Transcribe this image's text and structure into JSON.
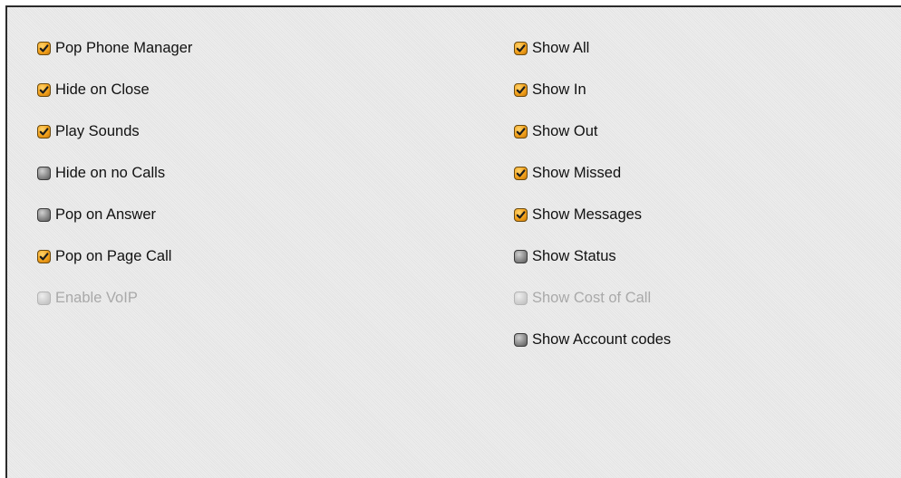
{
  "colors": {
    "checked_fill": "#f3a21c",
    "unchecked_fill": "#8c8c8c",
    "disabled_fill": "#cfcfcf",
    "panel_background": "#e9e9e9",
    "text": "#111111",
    "disabled_text": "#a9a9a9"
  },
  "left_options": [
    {
      "label": "Pop Phone Manager",
      "state": "checked"
    },
    {
      "label": "Hide on Close",
      "state": "checked"
    },
    {
      "label": "Play Sounds",
      "state": "checked"
    },
    {
      "label": "Hide on no Calls",
      "state": "unchecked"
    },
    {
      "label": "Pop on Answer",
      "state": "unchecked"
    },
    {
      "label": "Pop on Page Call",
      "state": "checked"
    },
    {
      "label": "Enable VoIP",
      "state": "disabled"
    }
  ],
  "right_options": [
    {
      "label": "Show All",
      "state": "checked"
    },
    {
      "label": "Show In",
      "state": "checked"
    },
    {
      "label": "Show Out",
      "state": "checked"
    },
    {
      "label": "Show Missed",
      "state": "checked"
    },
    {
      "label": "Show Messages",
      "state": "checked"
    },
    {
      "label": "Show Status",
      "state": "unchecked"
    },
    {
      "label": "Show Cost of Call",
      "state": "disabled"
    },
    {
      "label": "Show Account codes",
      "state": "unchecked"
    }
  ]
}
